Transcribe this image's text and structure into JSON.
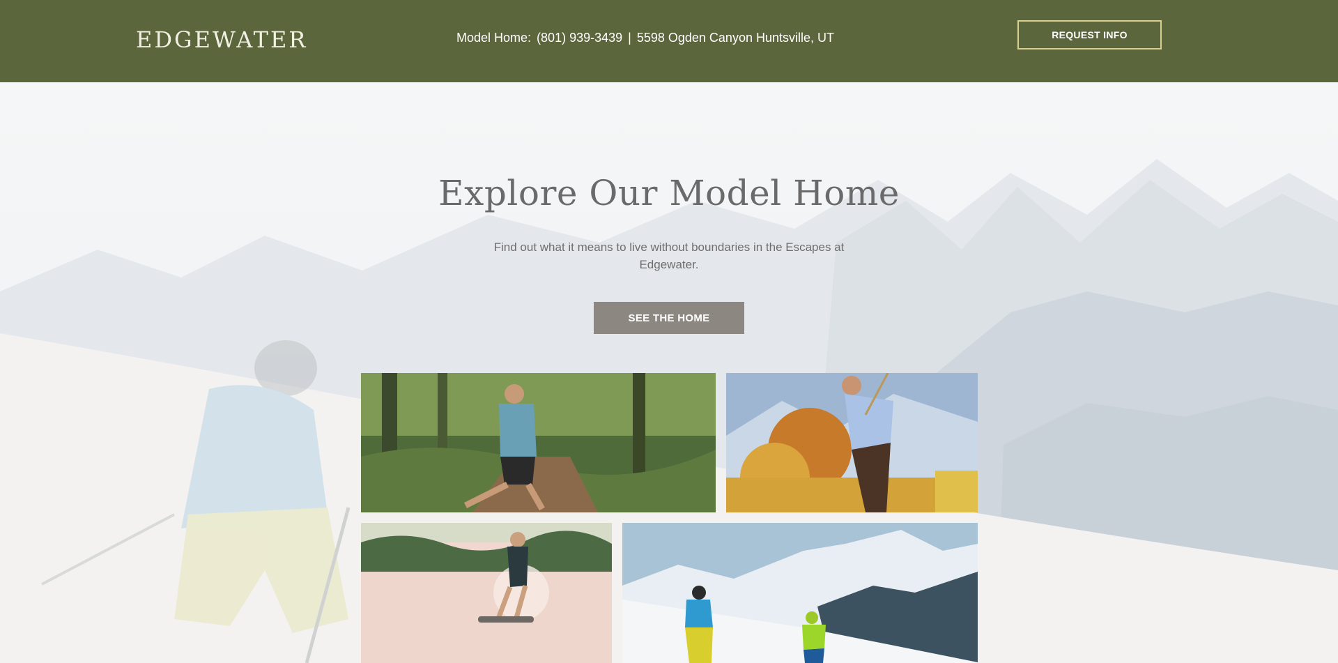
{
  "header": {
    "logo": "EDGEWATER",
    "model_home_label": "Model Home:",
    "phone": "(801) 939-3439",
    "separator": "|",
    "address": "5598 Ogden Canyon Huntsville, UT",
    "request_button": "REQUEST INFO"
  },
  "hero": {
    "title": "Explore Our Model Home",
    "subtitle": "Find out what it means to live without boundaries in the Escapes at Edgewater.",
    "cta_button": "SEE THE HOME",
    "background": "skier-snow-mountain-photo"
  },
  "gallery": {
    "photos": [
      {
        "name": "trail-hiking-photo"
      },
      {
        "name": "golf-swing-photo"
      },
      {
        "name": "wakeboarding-photo"
      },
      {
        "name": "skiing-photo"
      }
    ]
  },
  "colors": {
    "header_bg": "#5b663d",
    "button_border": "#d9d08f",
    "cta_bg": "#8c8781",
    "title_text": "#6a6a6a"
  }
}
